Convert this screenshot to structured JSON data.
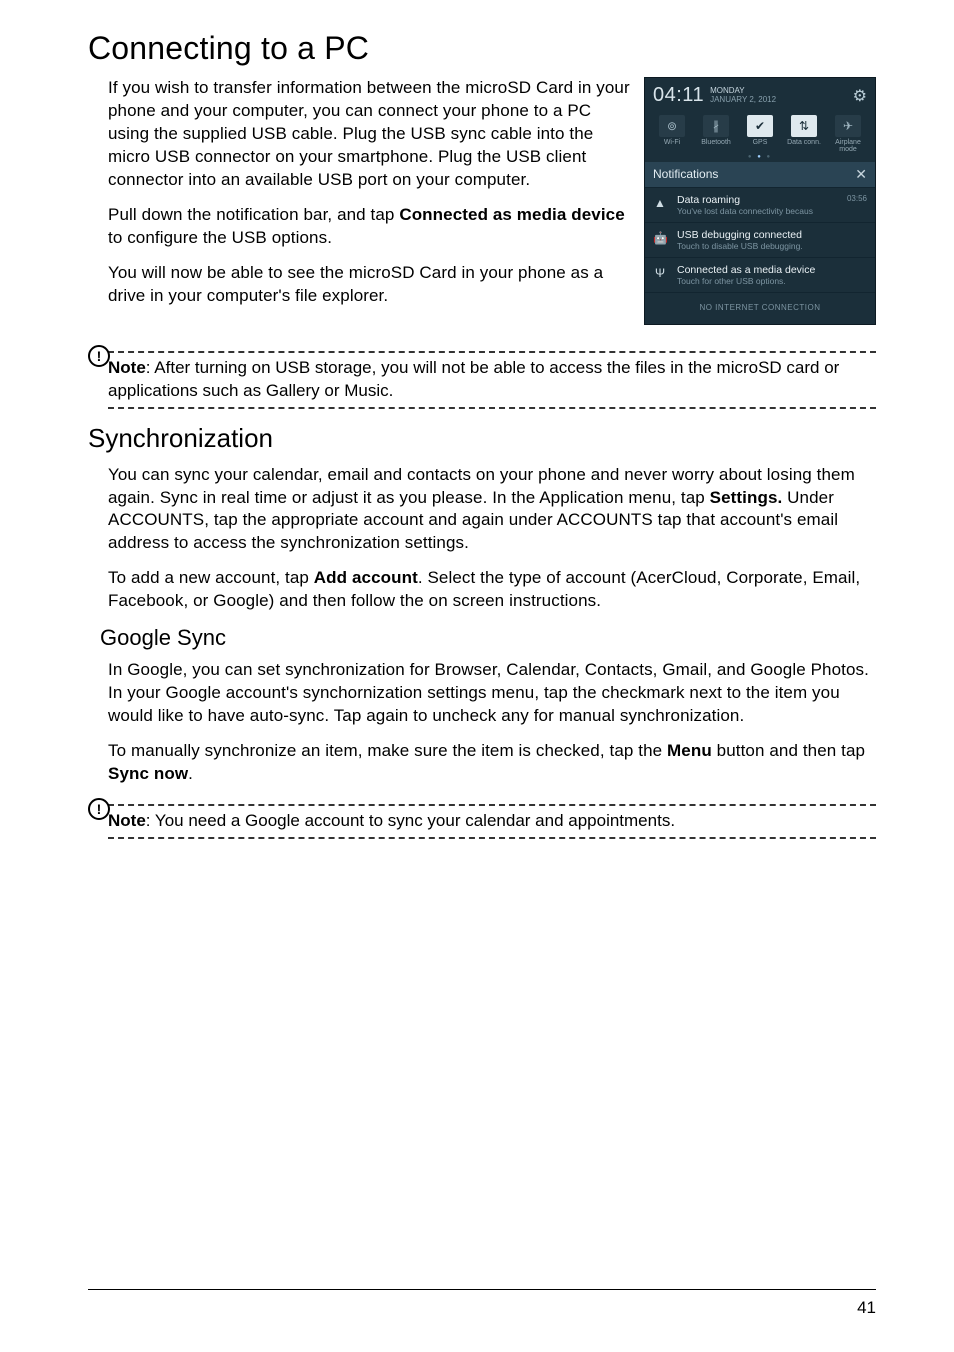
{
  "page_number": "41",
  "h1": "Connecting to a PC",
  "p1": "If you wish to transfer information between the microSD Card in your phone and your computer, you can connect your phone to a PC using the supplied USB cable. Plug the USB sync cable into the micro USB connector on your smartphone. Plug the USB client connector into an available USB port on your computer.",
  "p2a": "Pull down the notification bar, and tap ",
  "p2b": "Connected as media device",
  "p2c": " to configure the USB options.",
  "p3": "You will now be able to see the microSD Card in your phone as a drive in your computer's file explorer.",
  "note1a": "Note",
  "note1b": ": After turning on USB storage, you will not be able to access the files in the microSD card or applications such as Gallery or Music.",
  "h2": "Synchronization",
  "p4a": "You can sync your calendar, email and contacts on your phone and never worry about losing them again. Sync in real time or adjust it as you please. In the Application menu, tap ",
  "p4b": "Settings.",
  "p4c": " Under ACCOUNTS, tap the appropriate account and again under ACCOUNTS tap that account's email address to access the synchronization settings.",
  "p5a": "To add a new account, tap ",
  "p5b": "Add account",
  "p5c": ". Select the type of account (AcerCloud, Corporate, Email, Facebook, or Google) and then follow the on screen instructions.",
  "h3": "Google Sync",
  "p6": "In Google, you can set synchronization for Browser, Calendar, Contacts, Gmail, and Google Photos. In your Google account's synchornization settings menu, tap the checkmark next to the item you would like to have auto-sync. Tap again to uncheck any for manual synchronization.",
  "p7a": "To manually synchronize an item, make sure the item is checked, tap the ",
  "p7b": "Menu",
  "p7c": " button and then tap ",
  "p7d": "Sync now",
  "p7e": ".",
  "note2a": "Note",
  "note2b": ": You need a Google account to sync your calendar and appointments.",
  "screenshot": {
    "time": "04:11",
    "date_dow": "MONDAY",
    "date_full": "JANUARY 2, 2012",
    "toggles": {
      "wifi": "Wi-Fi",
      "bt": "Bluetooth",
      "gps": "GPS",
      "data": "Data conn.",
      "air": "Airplane mode"
    },
    "section": "Notifications",
    "items": [
      {
        "title": "Data roaming",
        "sub": "You've lost data connectivity becaus",
        "time": "03:56"
      },
      {
        "title": "USB debugging connected",
        "sub": "Touch to disable USB debugging.",
        "time": ""
      },
      {
        "title": "Connected as a media device",
        "sub": "Touch for other USB options.",
        "time": ""
      }
    ],
    "footer": "NO INTERNET CONNECTION"
  }
}
